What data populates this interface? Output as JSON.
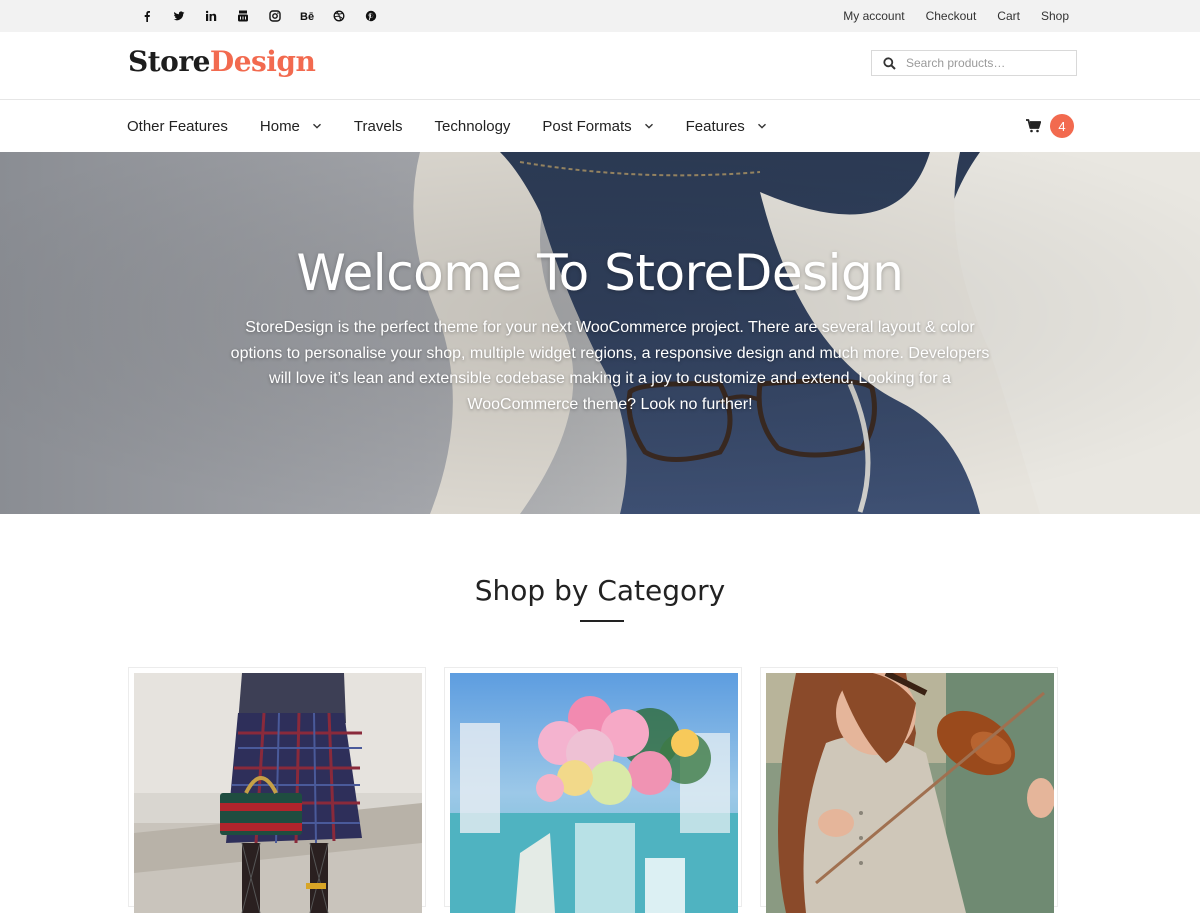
{
  "topbar": {
    "social_icons": [
      "facebook-icon",
      "twitter-icon",
      "linkedin-icon",
      "youtube-icon",
      "instagram-icon",
      "behance-icon",
      "dribbble-icon",
      "pinterest-icon"
    ],
    "links": [
      "My account",
      "Checkout",
      "Cart",
      "Shop"
    ]
  },
  "header": {
    "logo_part1": "Store",
    "logo_part2": "Design",
    "search_placeholder": "Search products…"
  },
  "nav": {
    "items": [
      {
        "label": "Other Features",
        "dropdown": false
      },
      {
        "label": "Home",
        "dropdown": true
      },
      {
        "label": "Travels",
        "dropdown": false
      },
      {
        "label": "Technology",
        "dropdown": false
      },
      {
        "label": "Post Formats",
        "dropdown": true
      },
      {
        "label": "Features",
        "dropdown": true
      }
    ],
    "cart_count": "4"
  },
  "hero": {
    "title": "Welcome To StoreDesign",
    "text": "StoreDesign is the perfect theme for your next WooCommerce project. There are several layout & color options to personalise your shop, multiple widget regions, a responsive design and much more. Developers will love it’s lean and extensible codebase making it a joy to customize and extend. Looking for a WooCommerce theme? Look no further!"
  },
  "categories": {
    "title": "Shop by Category"
  },
  "colors": {
    "accent": "#f26a4f",
    "topbar_bg": "#f2f2f2",
    "text": "#222222"
  }
}
